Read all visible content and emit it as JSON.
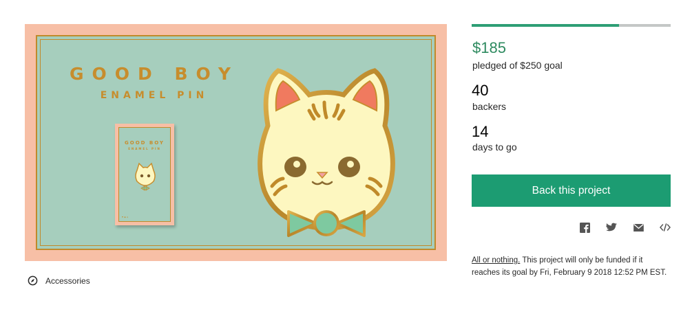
{
  "hero": {
    "title": "GOOD BOY",
    "subtitle": "ENAMEL PIN",
    "card_title": "GOOD BOY",
    "card_subtitle": "ENAMEL PIN",
    "card_footer": "♥ ● ◎",
    "colors": {
      "outer": "#f7bfa6",
      "inner": "#a6cebd",
      "gold": "#c78d2d",
      "face": "#fdf7c0",
      "bow": "#7ec9a0"
    }
  },
  "category": {
    "icon": "compass-icon",
    "label": "Accessories"
  },
  "funding": {
    "progress_fraction": 0.74,
    "pledged_amount": "$185",
    "pledged_label": "pledged of $250 goal",
    "backers_count": "40",
    "backers_label": "backers",
    "days_count": "14",
    "days_label": "days to go"
  },
  "actions": {
    "back_button": "Back this project",
    "share_icons": [
      "facebook-icon",
      "twitter-icon",
      "email-icon",
      "embed-icon"
    ]
  },
  "fineprint": {
    "all_or_nothing": "All or nothing.",
    "text": " This project will only be funded if it reaches its goal by Fri, February 9 2018 12:52 PM EST."
  },
  "colors": {
    "accent": "#1c9c72",
    "progress_track": "#c4c7c6",
    "amount": "#2d8a5f"
  }
}
